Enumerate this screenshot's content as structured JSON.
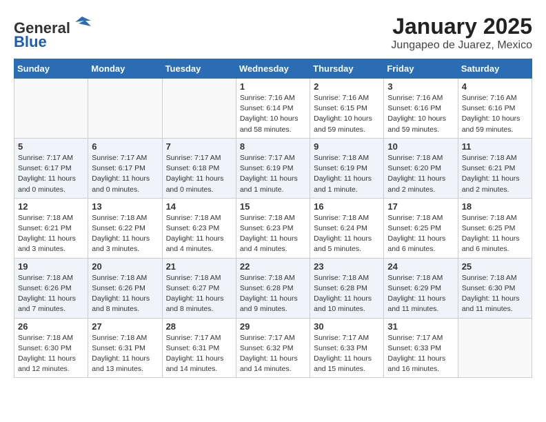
{
  "header": {
    "logo_general": "General",
    "logo_blue": "Blue",
    "month_title": "January 2025",
    "location": "Jungapeo de Juarez, Mexico"
  },
  "weekdays": [
    "Sunday",
    "Monday",
    "Tuesday",
    "Wednesday",
    "Thursday",
    "Friday",
    "Saturday"
  ],
  "weeks": [
    [
      {
        "day": "",
        "info": ""
      },
      {
        "day": "",
        "info": ""
      },
      {
        "day": "",
        "info": ""
      },
      {
        "day": "1",
        "info": "Sunrise: 7:16 AM\nSunset: 6:14 PM\nDaylight: 10 hours\nand 58 minutes."
      },
      {
        "day": "2",
        "info": "Sunrise: 7:16 AM\nSunset: 6:15 PM\nDaylight: 10 hours\nand 59 minutes."
      },
      {
        "day": "3",
        "info": "Sunrise: 7:16 AM\nSunset: 6:16 PM\nDaylight: 10 hours\nand 59 minutes."
      },
      {
        "day": "4",
        "info": "Sunrise: 7:16 AM\nSunset: 6:16 PM\nDaylight: 10 hours\nand 59 minutes."
      }
    ],
    [
      {
        "day": "5",
        "info": "Sunrise: 7:17 AM\nSunset: 6:17 PM\nDaylight: 11 hours\nand 0 minutes."
      },
      {
        "day": "6",
        "info": "Sunrise: 7:17 AM\nSunset: 6:17 PM\nDaylight: 11 hours\nand 0 minutes."
      },
      {
        "day": "7",
        "info": "Sunrise: 7:17 AM\nSunset: 6:18 PM\nDaylight: 11 hours\nand 0 minutes."
      },
      {
        "day": "8",
        "info": "Sunrise: 7:17 AM\nSunset: 6:19 PM\nDaylight: 11 hours\nand 1 minute."
      },
      {
        "day": "9",
        "info": "Sunrise: 7:18 AM\nSunset: 6:19 PM\nDaylight: 11 hours\nand 1 minute."
      },
      {
        "day": "10",
        "info": "Sunrise: 7:18 AM\nSunset: 6:20 PM\nDaylight: 11 hours\nand 2 minutes."
      },
      {
        "day": "11",
        "info": "Sunrise: 7:18 AM\nSunset: 6:21 PM\nDaylight: 11 hours\nand 2 minutes."
      }
    ],
    [
      {
        "day": "12",
        "info": "Sunrise: 7:18 AM\nSunset: 6:21 PM\nDaylight: 11 hours\nand 3 minutes."
      },
      {
        "day": "13",
        "info": "Sunrise: 7:18 AM\nSunset: 6:22 PM\nDaylight: 11 hours\nand 3 minutes."
      },
      {
        "day": "14",
        "info": "Sunrise: 7:18 AM\nSunset: 6:23 PM\nDaylight: 11 hours\nand 4 minutes."
      },
      {
        "day": "15",
        "info": "Sunrise: 7:18 AM\nSunset: 6:23 PM\nDaylight: 11 hours\nand 4 minutes."
      },
      {
        "day": "16",
        "info": "Sunrise: 7:18 AM\nSunset: 6:24 PM\nDaylight: 11 hours\nand 5 minutes."
      },
      {
        "day": "17",
        "info": "Sunrise: 7:18 AM\nSunset: 6:25 PM\nDaylight: 11 hours\nand 6 minutes."
      },
      {
        "day": "18",
        "info": "Sunrise: 7:18 AM\nSunset: 6:25 PM\nDaylight: 11 hours\nand 6 minutes."
      }
    ],
    [
      {
        "day": "19",
        "info": "Sunrise: 7:18 AM\nSunset: 6:26 PM\nDaylight: 11 hours\nand 7 minutes."
      },
      {
        "day": "20",
        "info": "Sunrise: 7:18 AM\nSunset: 6:26 PM\nDaylight: 11 hours\nand 8 minutes."
      },
      {
        "day": "21",
        "info": "Sunrise: 7:18 AM\nSunset: 6:27 PM\nDaylight: 11 hours\nand 8 minutes."
      },
      {
        "day": "22",
        "info": "Sunrise: 7:18 AM\nSunset: 6:28 PM\nDaylight: 11 hours\nand 9 minutes."
      },
      {
        "day": "23",
        "info": "Sunrise: 7:18 AM\nSunset: 6:28 PM\nDaylight: 11 hours\nand 10 minutes."
      },
      {
        "day": "24",
        "info": "Sunrise: 7:18 AM\nSunset: 6:29 PM\nDaylight: 11 hours\nand 11 minutes."
      },
      {
        "day": "25",
        "info": "Sunrise: 7:18 AM\nSunset: 6:30 PM\nDaylight: 11 hours\nand 11 minutes."
      }
    ],
    [
      {
        "day": "26",
        "info": "Sunrise: 7:18 AM\nSunset: 6:30 PM\nDaylight: 11 hours\nand 12 minutes."
      },
      {
        "day": "27",
        "info": "Sunrise: 7:18 AM\nSunset: 6:31 PM\nDaylight: 11 hours\nand 13 minutes."
      },
      {
        "day": "28",
        "info": "Sunrise: 7:17 AM\nSunset: 6:31 PM\nDaylight: 11 hours\nand 14 minutes."
      },
      {
        "day": "29",
        "info": "Sunrise: 7:17 AM\nSunset: 6:32 PM\nDaylight: 11 hours\nand 14 minutes."
      },
      {
        "day": "30",
        "info": "Sunrise: 7:17 AM\nSunset: 6:33 PM\nDaylight: 11 hours\nand 15 minutes."
      },
      {
        "day": "31",
        "info": "Sunrise: 7:17 AM\nSunset: 6:33 PM\nDaylight: 11 hours\nand 16 minutes."
      },
      {
        "day": "",
        "info": ""
      }
    ]
  ]
}
